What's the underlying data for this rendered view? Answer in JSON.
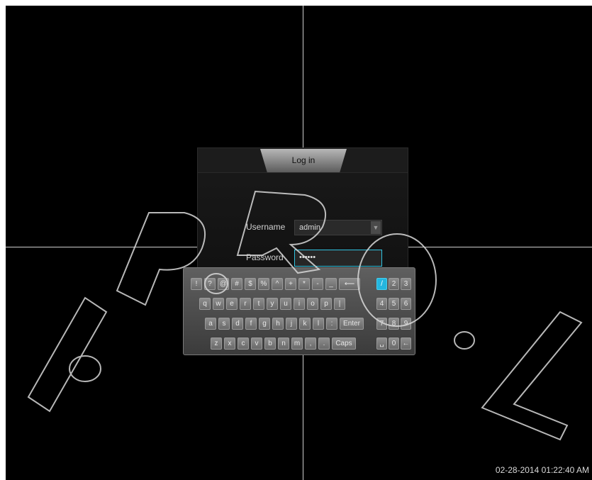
{
  "dialog": {
    "title": "Log in",
    "username_label": "Username",
    "username_value": "admin",
    "password_label": "Password",
    "password_value": "••••••"
  },
  "keyboard": {
    "rows": [
      [
        "!",
        "?",
        "@",
        "#",
        "$",
        "%",
        "^",
        "+",
        "*",
        "-",
        "_",
        "⟵"
      ],
      [
        "q",
        "w",
        "e",
        "r",
        "t",
        "y",
        "u",
        "i",
        "o",
        "p",
        "|"
      ],
      [
        "a",
        "s",
        "d",
        "f",
        "g",
        "h",
        "j",
        "k",
        "l",
        ":",
        "Enter"
      ],
      [
        "z",
        "x",
        "c",
        "v",
        "b",
        "n",
        "m",
        ",",
        ".",
        "Caps"
      ]
    ],
    "numpad": [
      [
        "/",
        "2",
        "3"
      ],
      [
        "4",
        "5",
        "6"
      ],
      [
        "7",
        "8",
        "9"
      ],
      [
        "␣",
        "0",
        "←"
      ]
    ],
    "selected_key": "/"
  },
  "status": {
    "timestamp": "02-28-2014 01:22:40 AM"
  },
  "watermark": "I.P.R.O.L",
  "colors": {
    "background": "#000000",
    "accent": "#24b6df"
  }
}
